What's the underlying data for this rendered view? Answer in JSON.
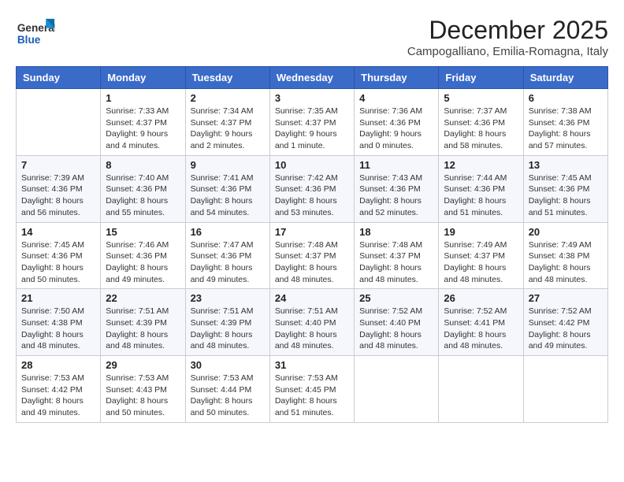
{
  "logo": {
    "line1": "General",
    "line2": "Blue"
  },
  "title": "December 2025",
  "location": "Campogalliano, Emilia-Romagna, Italy",
  "headers": [
    "Sunday",
    "Monday",
    "Tuesday",
    "Wednesday",
    "Thursday",
    "Friday",
    "Saturday"
  ],
  "weeks": [
    [
      {
        "day": "",
        "info": ""
      },
      {
        "day": "1",
        "info": "Sunrise: 7:33 AM\nSunset: 4:37 PM\nDaylight: 9 hours\nand 4 minutes."
      },
      {
        "day": "2",
        "info": "Sunrise: 7:34 AM\nSunset: 4:37 PM\nDaylight: 9 hours\nand 2 minutes."
      },
      {
        "day": "3",
        "info": "Sunrise: 7:35 AM\nSunset: 4:37 PM\nDaylight: 9 hours\nand 1 minute."
      },
      {
        "day": "4",
        "info": "Sunrise: 7:36 AM\nSunset: 4:36 PM\nDaylight: 9 hours\nand 0 minutes."
      },
      {
        "day": "5",
        "info": "Sunrise: 7:37 AM\nSunset: 4:36 PM\nDaylight: 8 hours\nand 58 minutes."
      },
      {
        "day": "6",
        "info": "Sunrise: 7:38 AM\nSunset: 4:36 PM\nDaylight: 8 hours\nand 57 minutes."
      }
    ],
    [
      {
        "day": "7",
        "info": "Sunrise: 7:39 AM\nSunset: 4:36 PM\nDaylight: 8 hours\nand 56 minutes."
      },
      {
        "day": "8",
        "info": "Sunrise: 7:40 AM\nSunset: 4:36 PM\nDaylight: 8 hours\nand 55 minutes."
      },
      {
        "day": "9",
        "info": "Sunrise: 7:41 AM\nSunset: 4:36 PM\nDaylight: 8 hours\nand 54 minutes."
      },
      {
        "day": "10",
        "info": "Sunrise: 7:42 AM\nSunset: 4:36 PM\nDaylight: 8 hours\nand 53 minutes."
      },
      {
        "day": "11",
        "info": "Sunrise: 7:43 AM\nSunset: 4:36 PM\nDaylight: 8 hours\nand 52 minutes."
      },
      {
        "day": "12",
        "info": "Sunrise: 7:44 AM\nSunset: 4:36 PM\nDaylight: 8 hours\nand 51 minutes."
      },
      {
        "day": "13",
        "info": "Sunrise: 7:45 AM\nSunset: 4:36 PM\nDaylight: 8 hours\nand 51 minutes."
      }
    ],
    [
      {
        "day": "14",
        "info": "Sunrise: 7:45 AM\nSunset: 4:36 PM\nDaylight: 8 hours\nand 50 minutes."
      },
      {
        "day": "15",
        "info": "Sunrise: 7:46 AM\nSunset: 4:36 PM\nDaylight: 8 hours\nand 49 minutes."
      },
      {
        "day": "16",
        "info": "Sunrise: 7:47 AM\nSunset: 4:36 PM\nDaylight: 8 hours\nand 49 minutes."
      },
      {
        "day": "17",
        "info": "Sunrise: 7:48 AM\nSunset: 4:37 PM\nDaylight: 8 hours\nand 48 minutes."
      },
      {
        "day": "18",
        "info": "Sunrise: 7:48 AM\nSunset: 4:37 PM\nDaylight: 8 hours\nand 48 minutes."
      },
      {
        "day": "19",
        "info": "Sunrise: 7:49 AM\nSunset: 4:37 PM\nDaylight: 8 hours\nand 48 minutes."
      },
      {
        "day": "20",
        "info": "Sunrise: 7:49 AM\nSunset: 4:38 PM\nDaylight: 8 hours\nand 48 minutes."
      }
    ],
    [
      {
        "day": "21",
        "info": "Sunrise: 7:50 AM\nSunset: 4:38 PM\nDaylight: 8 hours\nand 48 minutes."
      },
      {
        "day": "22",
        "info": "Sunrise: 7:51 AM\nSunset: 4:39 PM\nDaylight: 8 hours\nand 48 minutes."
      },
      {
        "day": "23",
        "info": "Sunrise: 7:51 AM\nSunset: 4:39 PM\nDaylight: 8 hours\nand 48 minutes."
      },
      {
        "day": "24",
        "info": "Sunrise: 7:51 AM\nSunset: 4:40 PM\nDaylight: 8 hours\nand 48 minutes."
      },
      {
        "day": "25",
        "info": "Sunrise: 7:52 AM\nSunset: 4:40 PM\nDaylight: 8 hours\nand 48 minutes."
      },
      {
        "day": "26",
        "info": "Sunrise: 7:52 AM\nSunset: 4:41 PM\nDaylight: 8 hours\nand 48 minutes."
      },
      {
        "day": "27",
        "info": "Sunrise: 7:52 AM\nSunset: 4:42 PM\nDaylight: 8 hours\nand 49 minutes."
      }
    ],
    [
      {
        "day": "28",
        "info": "Sunrise: 7:53 AM\nSunset: 4:42 PM\nDaylight: 8 hours\nand 49 minutes."
      },
      {
        "day": "29",
        "info": "Sunrise: 7:53 AM\nSunset: 4:43 PM\nDaylight: 8 hours\nand 50 minutes."
      },
      {
        "day": "30",
        "info": "Sunrise: 7:53 AM\nSunset: 4:44 PM\nDaylight: 8 hours\nand 50 minutes."
      },
      {
        "day": "31",
        "info": "Sunrise: 7:53 AM\nSunset: 4:45 PM\nDaylight: 8 hours\nand 51 minutes."
      },
      {
        "day": "",
        "info": ""
      },
      {
        "day": "",
        "info": ""
      },
      {
        "day": "",
        "info": ""
      }
    ]
  ]
}
